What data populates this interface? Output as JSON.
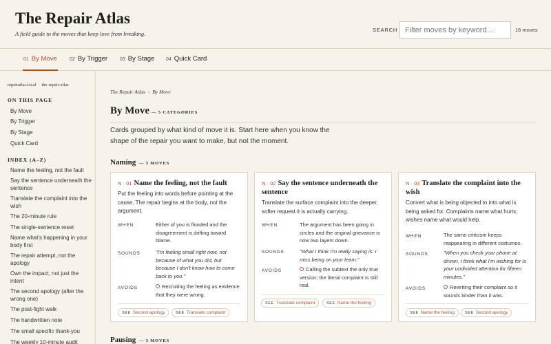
{
  "header": {
    "title": "The Repair Atlas",
    "tagline": "A field guide to the moves that keep love from breaking.",
    "search_label": "SEARCH",
    "search_placeholder": "Filter moves by keyword…",
    "search_value": "",
    "count": "16 moves"
  },
  "tabs": [
    {
      "num": "01",
      "label": "By Move"
    },
    {
      "num": "02",
      "label": "By Trigger"
    },
    {
      "num": "03",
      "label": "By Stage"
    },
    {
      "num": "04",
      "label": "Quick Card"
    }
  ],
  "sidebar": {
    "crumb_host": "repairatlas.local",
    "crumb_sep": "·",
    "crumb_path": "the-repair-atlas",
    "on_this_page_heading": "ON THIS PAGE",
    "on_this_page": [
      "By Move",
      "By Trigger",
      "By Stage",
      "Quick Card"
    ],
    "index_heading": "INDEX (A–Z)",
    "index": [
      "Name the feeling, not the fault",
      "Say the sentence underneath the sentence",
      "Translate the complaint into the wish",
      "The 20-minute rule",
      "The single-sentence reset",
      "Name what's happening in your body first",
      "The repair attempt, not the apology",
      "Own the impact, not just the intent",
      "The second apology (after the wrong one)",
      "The post-fight walk",
      "The handwritten note",
      "The small specific thank-you",
      "The weekly 10-minute audit"
    ]
  },
  "main": {
    "breadcrumb": [
      "The Repair Atlas",
      "By Move"
    ],
    "breadcrumb_sep": "›",
    "title": "By Move",
    "subtitle": "— 5 CATEGORIES",
    "intro": "Cards grouped by what kind of move it is. Start here when you know the shape of the repair you want to make, but not the moment.",
    "sections": [
      {
        "title": "Naming",
        "count": "— 3 MOVES"
      },
      {
        "title": "Pausing",
        "count": "— 3 MOVES"
      }
    ],
    "labels": {
      "when": "WHEN",
      "sounds": "SOUNDS",
      "avoids": "AVOIDS",
      "see": "SEE"
    },
    "cards": [
      {
        "num": "N · 01",
        "title": "Name the feeling, not the fault",
        "desc": "Put the feeling into words before pointing at the cause. The repair begins at the body, not the argument.",
        "when": "Either of you is flooded and the disagreement is drifting toward blame.",
        "sounds": "\"I'm feeling small right now, not because of what you did, but because I don't know how to come back to you.\"",
        "avoids": "Recruiting the feeling as evidence that they were wrong.",
        "see": [
          "Second apology",
          "Translate complaint"
        ]
      },
      {
        "num": "N · 02",
        "title": "Say the sentence underneath the sentence",
        "desc": "Translate the surface complaint into the deeper, softer request it is actually carrying.",
        "when": "The argument has been going in circles and the original grievance is now two layers down.",
        "sounds": "\"What I think I'm really saying is: I miss being on your team.\"",
        "avoids": "Calling the subtext the only true version; the literal complaint is still real.",
        "see": [
          "Translate complaint",
          "Name the feeling"
        ]
      },
      {
        "num": "N · 03",
        "title": "Translate the complaint into the wish",
        "desc": "Convert what is being objected to into what is being asked for. Complaints name what hurts; wishes name what would help.",
        "when": "The same criticism keeps reappearing in different costumes.",
        "sounds": "\"When you check your phone at dinner, I think what I'm wishing for is your undivided attention for fifteen minutes.\"",
        "avoids": "Rewriting their complaint so it sounds kinder than it was.",
        "see": [
          "Name the feeling",
          "Second apology"
        ]
      }
    ]
  },
  "colors": {
    "accent": "#b05030",
    "background": "#f7f3ea",
    "card": "#ffffff",
    "rule": "#ddd5c5"
  }
}
